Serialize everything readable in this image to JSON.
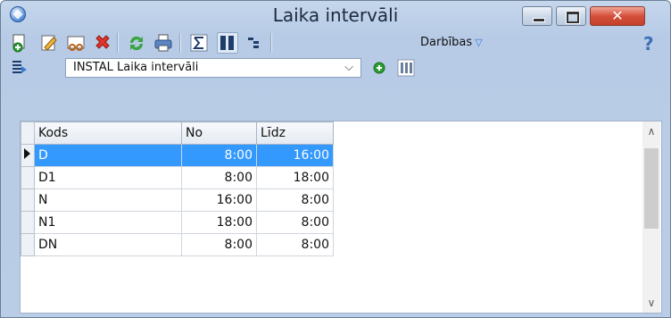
{
  "window": {
    "title": "Laika intervāli",
    "close_glyph": "✕"
  },
  "toolbar": {
    "actions_label": "Darbības",
    "actions_arrow": "▽",
    "help_glyph": "?",
    "icons": [
      "add-icon",
      "edit-icon",
      "copy-icon",
      "delete-icon",
      "refresh-icon",
      "print-icon",
      "sum-icon",
      "columns-icon",
      "tree-icon"
    ]
  },
  "toolbar2": {
    "combo_value": "INSTAL Laika intervāli",
    "combo_arrow": "⌵"
  },
  "grid": {
    "columns": [
      "Kods",
      "No",
      "Līdz"
    ],
    "rows": [
      {
        "kods": "D",
        "no": "8:00",
        "lidz": "16:00"
      },
      {
        "kods": "D1",
        "no": "8:00",
        "lidz": "18:00"
      },
      {
        "kods": "N",
        "no": "16:00",
        "lidz": "8:00"
      },
      {
        "kods": "N1",
        "no": "18:00",
        "lidz": "8:00"
      },
      {
        "kods": "DN",
        "no": "8:00",
        "lidz": "8:00"
      }
    ],
    "selected_row": 0
  },
  "scrollbar": {
    "up_glyph": "∧",
    "down_glyph": "∨"
  },
  "colors": {
    "selection": "#3399ff",
    "close": "#c3412c"
  }
}
